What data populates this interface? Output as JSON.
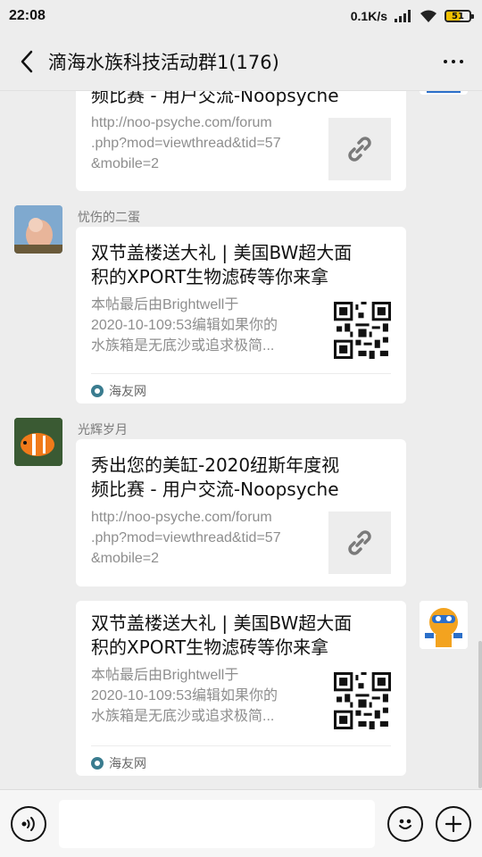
{
  "status": {
    "time": "22:08",
    "network_speed": "0.1K/s",
    "battery": "51"
  },
  "header": {
    "title": "滴海水族科技活动群1(176)"
  },
  "messages": [
    {
      "type": "link",
      "title_tail": "频比赛 - 用户交流-Noopsyche",
      "desc": [
        "http://noo-psyche.com/forum",
        ".php?mod=viewthread&tid=57",
        "&mobile=2"
      ]
    },
    {
      "type": "miniprogram",
      "sender": "忧伤的二蛋",
      "title": [
        "双节盖楼送大礼 | 美国BW超大面",
        "积的XPORT生物滤砖等你来拿"
      ],
      "desc": [
        "本帖最后由Brightwell于",
        "2020-10-109:53编辑如果你的",
        "水族箱是无底沙或追求极简..."
      ],
      "source": "海友网"
    },
    {
      "type": "link",
      "sender": "光辉岁月",
      "title": [
        "秀出您的美缸-2020纽斯年度视",
        "频比赛 - 用户交流-Noopsyche"
      ],
      "desc": [
        "http://noo-psyche.com/forum",
        ".php?mod=viewthread&tid=57",
        "&mobile=2"
      ]
    },
    {
      "type": "miniprogram",
      "title": [
        "双节盖楼送大礼 | 美国BW超大面",
        "积的XPORT生物滤砖等你来拿"
      ],
      "desc": [
        "本帖最后由Brightwell于",
        "2020-10-109:53编辑如果你的",
        "水族箱是无底沙或追求极简..."
      ],
      "source": "海友网"
    }
  ],
  "icons": {
    "back": "back-arrow-icon",
    "more": "more-dots-icon",
    "link": "link-chain-icon",
    "voice": "voice-icon",
    "emoji": "emoji-icon",
    "plus": "plus-icon"
  }
}
